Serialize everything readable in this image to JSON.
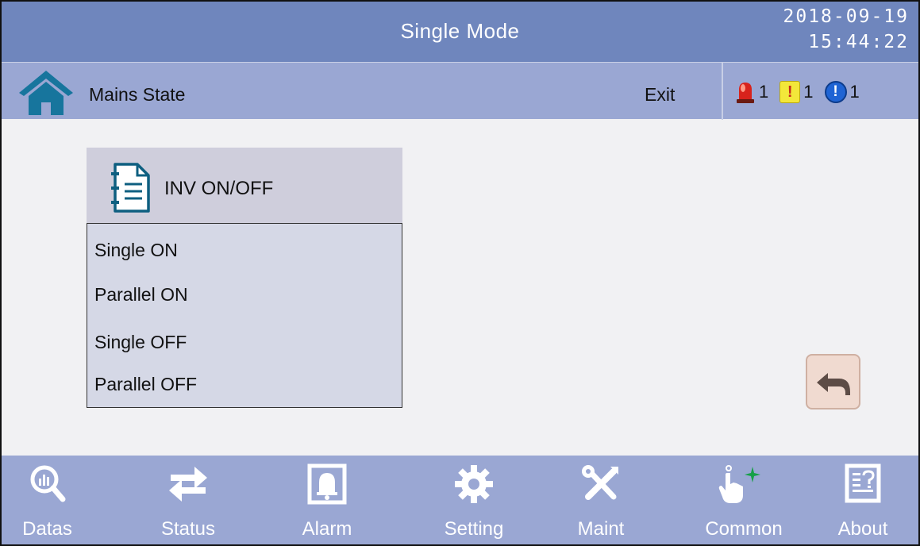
{
  "header": {
    "title": "Single Mode",
    "date": "2018-09-19",
    "time": "15:44:22"
  },
  "subheader": {
    "breadcrumb": "Mains State",
    "exit_label": "Exit",
    "alarms": [
      {
        "icon": "siren-icon",
        "count": "1"
      },
      {
        "icon": "warning-icon",
        "symbol": "!",
        "count": "1"
      },
      {
        "icon": "info-icon",
        "symbol": "!",
        "count": "1"
      }
    ]
  },
  "menu": {
    "title": "INV ON/OFF",
    "items": [
      "Single  ON",
      "Parallel ON",
      "Single  OFF",
      "Parallel  OFF"
    ]
  },
  "nav": {
    "items": [
      {
        "label": "Datas",
        "icon": "magnifier-chart-icon"
      },
      {
        "label": "Status",
        "icon": "swap-arrows-icon"
      },
      {
        "label": "Alarm",
        "icon": "bell-icon"
      },
      {
        "label": "Setting",
        "icon": "gear-icon"
      },
      {
        "label": "Maint",
        "icon": "tools-icon"
      },
      {
        "label": "Common",
        "icon": "pointer-hand-icon"
      },
      {
        "label": "About",
        "icon": "about-document-icon"
      }
    ]
  },
  "colors": {
    "title_bar": "#6f86bd",
    "sub_bar": "#9aa7d3",
    "content_bg": "#f1f1f3",
    "menu_header_bg": "#cfcedc",
    "menu_list_bg": "#d5d8e6",
    "back_button_bg": "#f0dad0",
    "home_icon": "#17759d"
  }
}
